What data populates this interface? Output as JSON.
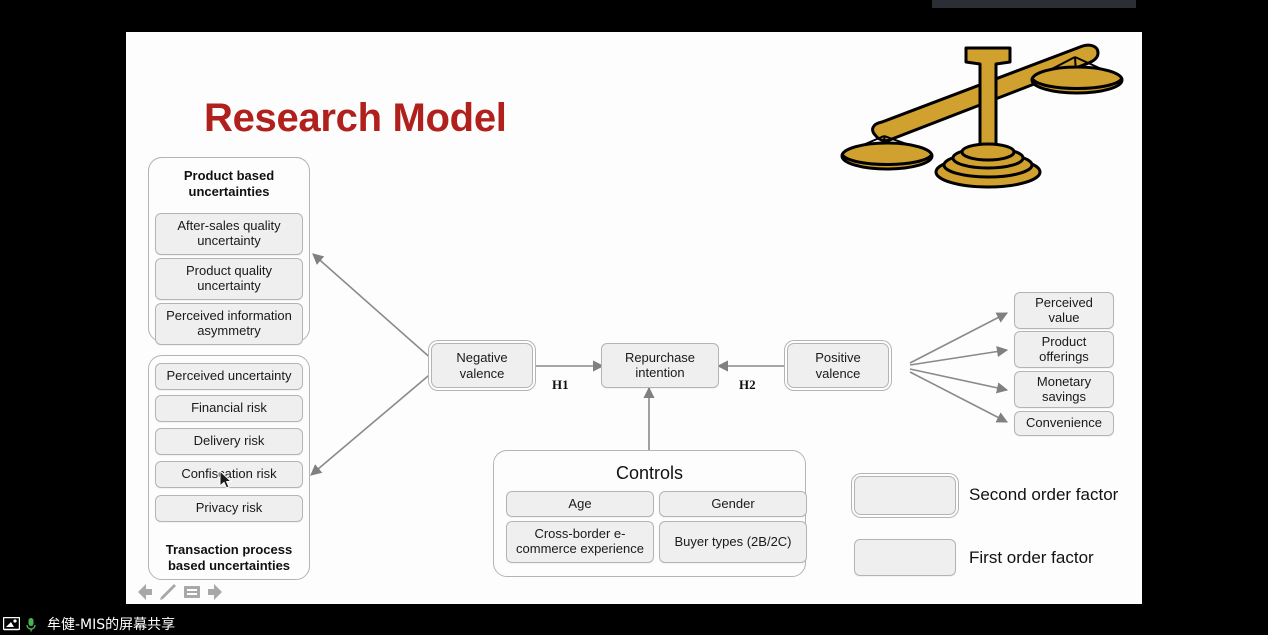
{
  "slide": {
    "title": "Research Model",
    "title_color": "#b0201c",
    "background": "#fdfdfd",
    "clipart": "balance-scale-icon"
  },
  "groups": {
    "product_based": {
      "title": "Product based uncertainties",
      "title_line1": "Product based",
      "title_line2": "uncertainties",
      "items": [
        {
          "label": "After-sales quality uncertainty",
          "line1": "After-sales quality",
          "line2": "uncertainty"
        },
        {
          "label": "Product quality uncertainty",
          "line1": "Product quality",
          "line2": "uncertainty"
        },
        {
          "label": "Perceived information asymmetry",
          "line1": "Perceived information",
          "line2": "asymmetry"
        }
      ]
    },
    "transaction_based": {
      "title": "Transaction process based uncertainties",
      "title_line1": "Transaction process",
      "title_line2": "based uncertainties",
      "items": [
        {
          "label": "Perceived uncertainty"
        },
        {
          "label": "Financial risk"
        },
        {
          "label": "Delivery risk"
        },
        {
          "label": "Confiscation risk"
        },
        {
          "label": "Privacy risk"
        }
      ]
    },
    "controls": {
      "title": "Controls",
      "items": [
        {
          "label": "Age",
          "line1": "Age",
          "line2": ""
        },
        {
          "label": "Gender",
          "line1": "Gender",
          "line2": ""
        },
        {
          "label": "Cross-border e-commerce experience",
          "line1": "Cross-border e-",
          "line2": "commerce experience"
        },
        {
          "label": "Buyer types (2B/2C)",
          "line1": "Buyer types (2B/2C)",
          "line2": ""
        }
      ]
    }
  },
  "core": {
    "negative_valence": {
      "line1": "Negative",
      "line2": "valence"
    },
    "repurchase_intention": {
      "line1": "Repurchase",
      "line2": "intention"
    },
    "positive_valence": {
      "line1": "Positive",
      "line2": "valence"
    }
  },
  "hypotheses": [
    {
      "id": "H1",
      "label": "H1"
    },
    {
      "id": "H2",
      "label": "H2"
    }
  ],
  "outcomes": [
    {
      "label": "Perceived value",
      "line1": "Perceived",
      "line2": "value"
    },
    {
      "label": "Product offerings",
      "line1": "Product",
      "line2": "offerings"
    },
    {
      "label": "Monetary savings",
      "line1": "Monetary",
      "line2": "savings"
    },
    {
      "label": "Convenience",
      "line1": "Convenience",
      "line2": ""
    }
  ],
  "legend": [
    {
      "key": "second-order",
      "label": "Second order factor"
    },
    {
      "key": "first-order",
      "label": "First order factor"
    }
  ],
  "slide_nav": [
    {
      "name": "previous-slide-icon",
      "glyph": "arrow-left"
    },
    {
      "name": "pen-tool-icon",
      "glyph": "pencil"
    },
    {
      "name": "slide-notes-icon",
      "glyph": "notes"
    },
    {
      "name": "next-slide-icon",
      "glyph": "arrow-right"
    }
  ],
  "statusbar": {
    "share_text": "牟健-MIS的屏幕共享",
    "mic_color": "#4caf50"
  }
}
